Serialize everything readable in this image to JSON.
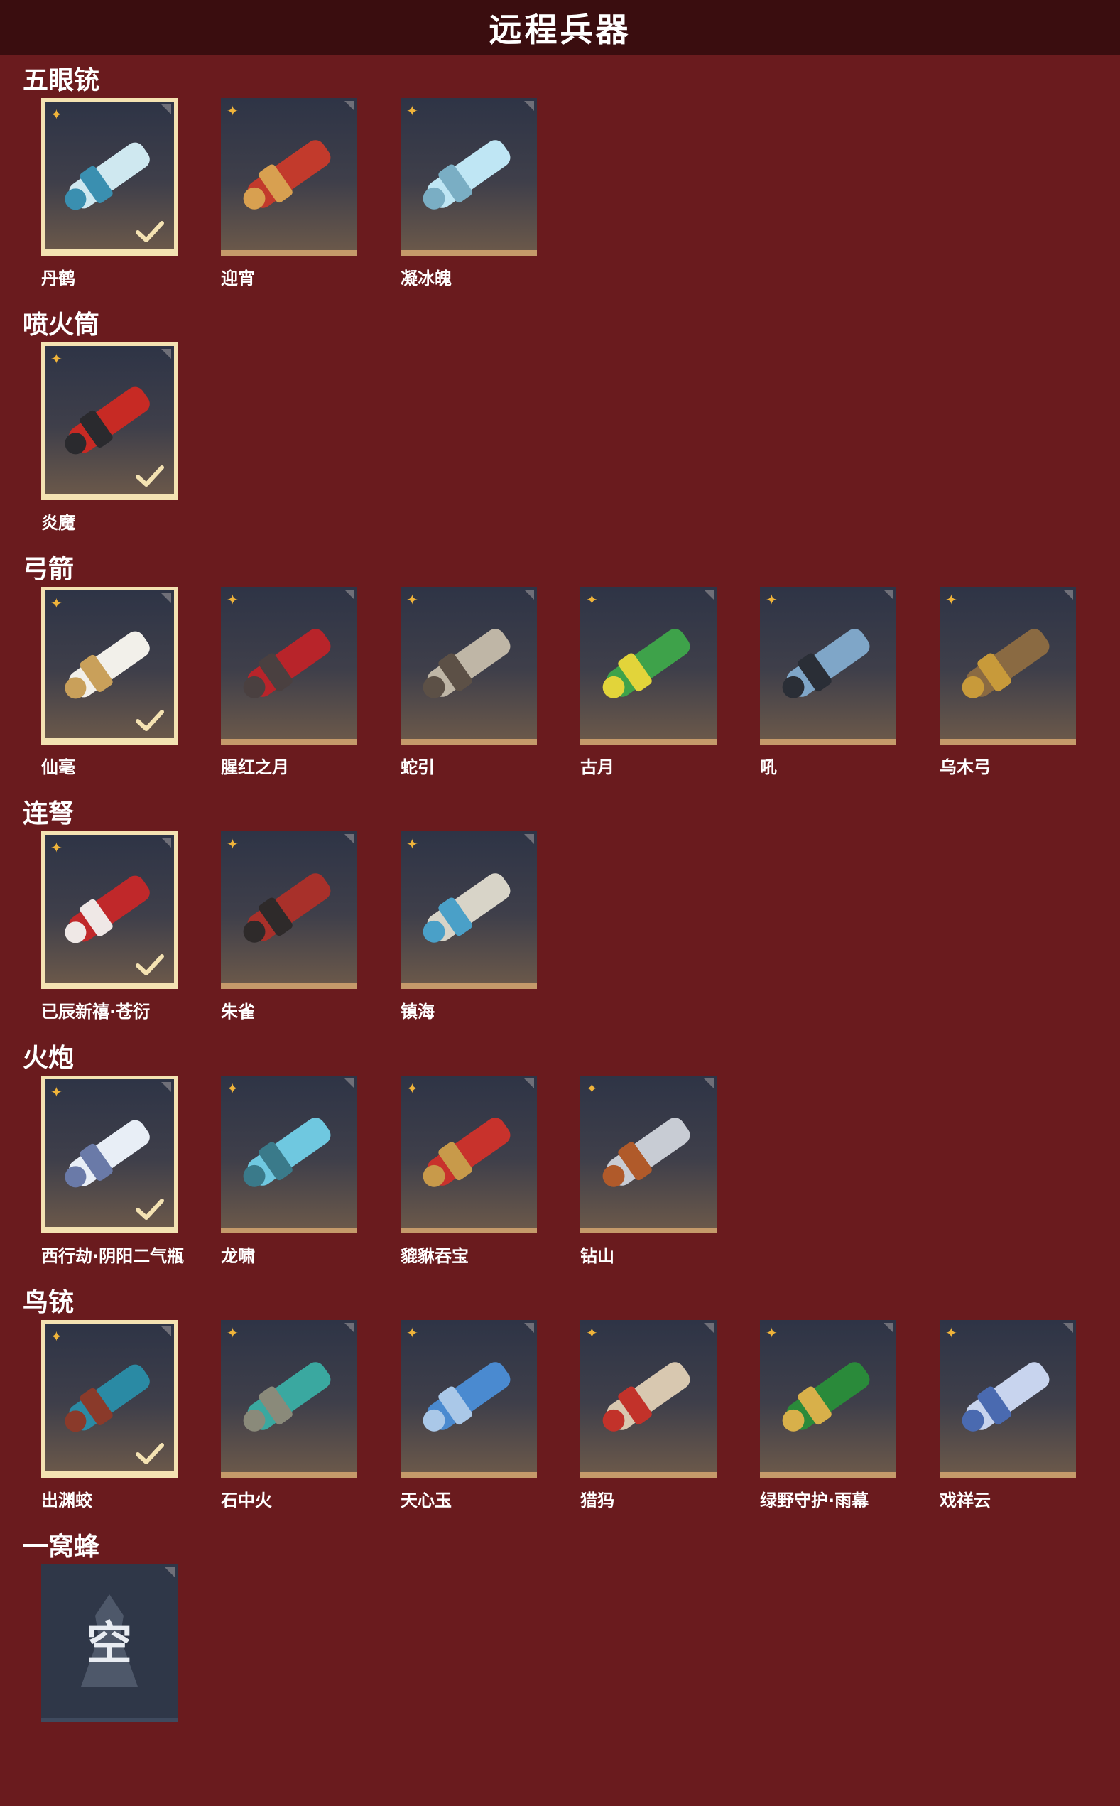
{
  "header": {
    "title": "远程兵器"
  },
  "colors": {
    "background": "#6a1b1e",
    "header": "#3a0d0f",
    "rarity": "#f0b43a",
    "selected_border": "#f4e2b2",
    "card_bottom": "#c59a6a"
  },
  "sections": [
    {
      "title": "五眼铳",
      "items": [
        {
          "name": "丹鹤",
          "selected": true,
          "art": [
            "#cfe8f0",
            "#3a8fb0"
          ]
        },
        {
          "name": "迎宵",
          "selected": false,
          "art": [
            "#c23a2c",
            "#d8a050"
          ]
        },
        {
          "name": "凝冰魄",
          "selected": false,
          "art": [
            "#bfe6f4",
            "#7aaec4"
          ]
        }
      ]
    },
    {
      "title": "喷火筒",
      "items": [
        {
          "name": "炎魔",
          "selected": true,
          "art": [
            "#c72a24",
            "#2a2a2e"
          ]
        }
      ]
    },
    {
      "title": "弓箭",
      "items": [
        {
          "name": "仙毫",
          "selected": true,
          "art": [
            "#f2f0ea",
            "#c9a05a"
          ]
        },
        {
          "name": "腥红之月",
          "selected": false,
          "art": [
            "#b8242a",
            "#4a4040"
          ]
        },
        {
          "name": "蛇引",
          "selected": false,
          "art": [
            "#bfb6a6",
            "#5c5046"
          ]
        },
        {
          "name": "古月",
          "selected": false,
          "art": [
            "#3ea24a",
            "#e2d43a"
          ]
        },
        {
          "name": "吼",
          "selected": false,
          "art": [
            "#7fa6c8",
            "#2a2e36"
          ]
        },
        {
          "name": "乌木弓",
          "selected": false,
          "art": [
            "#8a6a42",
            "#c89a3a"
          ]
        }
      ]
    },
    {
      "title": "连弩",
      "items": [
        {
          "name": "已辰新禧·苍衍",
          "selected": true,
          "art": [
            "#c0282a",
            "#efe8e6"
          ]
        },
        {
          "name": "朱雀",
          "selected": false,
          "art": [
            "#a8302a",
            "#2e2a2a"
          ]
        },
        {
          "name": "镇海",
          "selected": false,
          "art": [
            "#d8d4c8",
            "#4aa0c8"
          ]
        }
      ]
    },
    {
      "title": "火炮",
      "items": [
        {
          "name": "西行劫·阴阳二气瓶",
          "selected": true,
          "art": [
            "#e8eef6",
            "#6a7aa8"
          ]
        },
        {
          "name": "龙啸",
          "selected": false,
          "art": [
            "#6fc8e0",
            "#3a7a8a"
          ]
        },
        {
          "name": "貔貅吞宝",
          "selected": false,
          "art": [
            "#c8322c",
            "#c89a4a"
          ]
        },
        {
          "name": "钻山",
          "selected": false,
          "art": [
            "#c8ccd4",
            "#b05a2a"
          ]
        }
      ]
    },
    {
      "title": "鸟铳",
      "items": [
        {
          "name": "出渊蛟",
          "selected": true,
          "art": [
            "#2a8aa4",
            "#8a3a2a"
          ]
        },
        {
          "name": "石中火",
          "selected": false,
          "art": [
            "#3aa8a0",
            "#8a8a7a"
          ]
        },
        {
          "name": "天心玉",
          "selected": false,
          "art": [
            "#4a8ad0",
            "#aac8e8"
          ]
        },
        {
          "name": "猎犸",
          "selected": false,
          "art": [
            "#d8c8b0",
            "#c2322a"
          ]
        },
        {
          "name": "绿野守护·雨幕",
          "selected": false,
          "art": [
            "#2a8a3a",
            "#d8b04a"
          ]
        },
        {
          "name": "戏祥云",
          "selected": false,
          "art": [
            "#c8d4ee",
            "#4a6ab0"
          ]
        }
      ]
    },
    {
      "title": "一窝蜂",
      "items": [
        {
          "name": "",
          "empty": true,
          "empty_label": "空"
        }
      ]
    }
  ]
}
